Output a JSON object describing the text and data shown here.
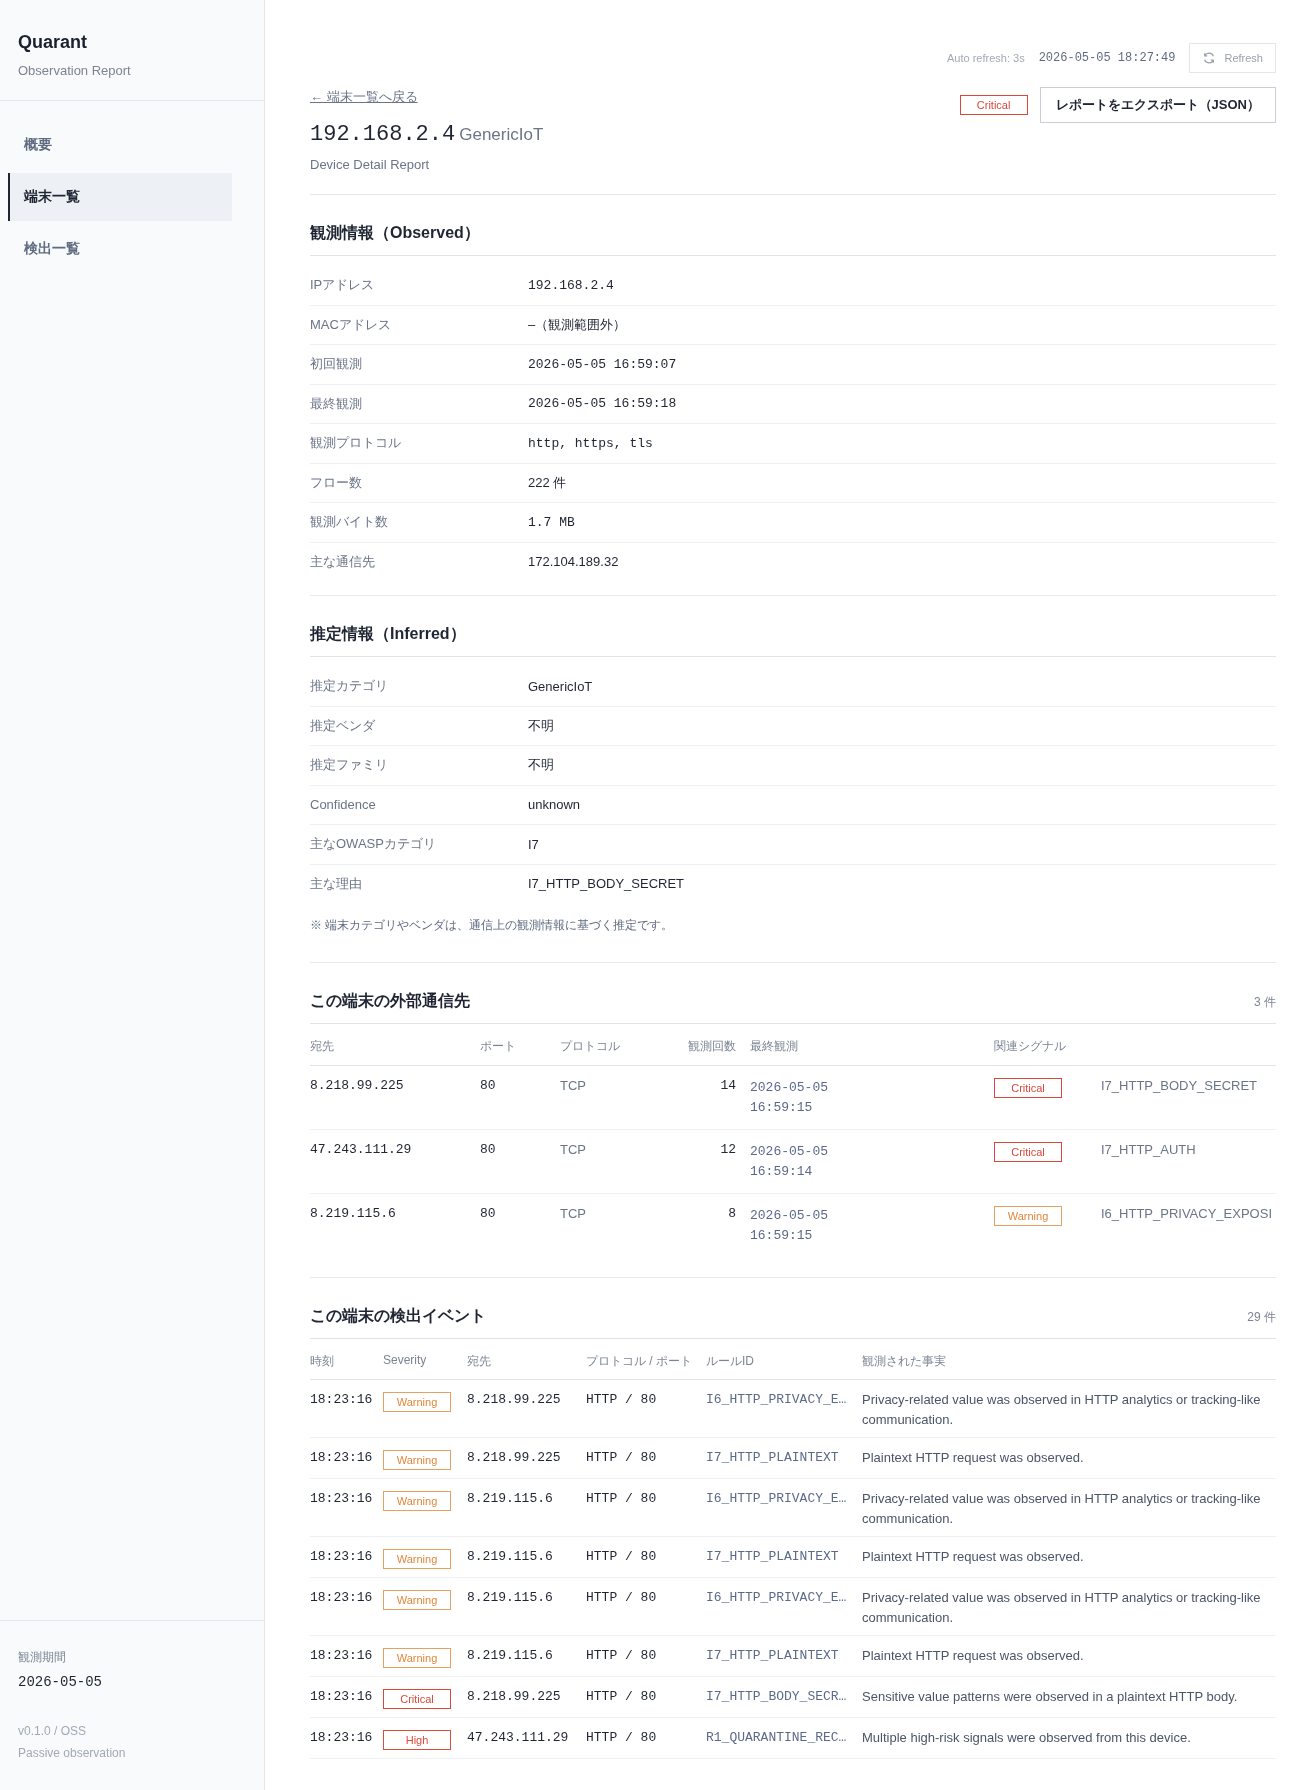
{
  "sidebar": {
    "brand": "Quarant",
    "subtitle": "Observation Report",
    "items": [
      {
        "label": "概要",
        "selected": false
      },
      {
        "label": "端末一覧",
        "selected": true
      },
      {
        "label": "検出一覧",
        "selected": false
      }
    ],
    "footer": {
      "period_label": "観測期間",
      "period": "2026-05-05",
      "version": "v0.1.0 / OSS",
      "mode": "Passive observation"
    }
  },
  "topbar": {
    "auto_refresh": "Auto refresh: 3s",
    "timestamp": "2026-05-05 18:27:49",
    "refresh_button": "Refresh"
  },
  "header": {
    "back_link": "← 端末一覧へ戻る",
    "ip": "192.168.2.4",
    "category": "GenericIoT",
    "subtitle": "Device Detail Report",
    "severity": {
      "label": "Critical",
      "kind": "critical"
    },
    "export_button": "レポートをエクスポート（JSON）"
  },
  "observed": {
    "title": "観測情報（Observed）",
    "rows": [
      {
        "label": "IPアドレス",
        "value": "192.168.2.4",
        "kind": "mono"
      },
      {
        "label": "MACアドレス",
        "value": "–（観測範囲外）",
        "kind": "text"
      },
      {
        "label": "初回観測",
        "value": "2026-05-05 16:59:07",
        "kind": "mono"
      },
      {
        "label": "最終観測",
        "value": "2026-05-05 16:59:18",
        "kind": "mono"
      },
      {
        "label": "観測プロトコル",
        "value": "http, https, tls",
        "kind": "mono"
      },
      {
        "label": "フロー数",
        "value": "222 件",
        "kind": "text"
      },
      {
        "label": "観測バイト数",
        "value": "1.7 MB",
        "kind": "mono"
      },
      {
        "label": "主な通信先",
        "value": "172.104.189.32",
        "kind": "text"
      }
    ]
  },
  "inferred": {
    "title": "推定情報（Inferred）",
    "rows": [
      {
        "label": "推定カテゴリ",
        "value": "GenericIoT",
        "kind": "text"
      },
      {
        "label": "推定ベンダ",
        "value": "不明",
        "kind": "text"
      },
      {
        "label": "推定ファミリ",
        "value": "不明",
        "kind": "text"
      },
      {
        "label": "Confidence",
        "value": "unknown",
        "kind": "text"
      },
      {
        "label": "主なOWASPカテゴリ",
        "value": "I7",
        "kind": "text"
      },
      {
        "label": "主な理由",
        "value": "I7_HTTP_BODY_SECRET",
        "kind": "text"
      }
    ],
    "note": "※ 端末カテゴリやベンダは、通信上の観測情報に基づく推定です。"
  },
  "destinations": {
    "title": "この端末の外部通信先",
    "count": "3 件",
    "columns": [
      "宛先",
      "ポート",
      "プロトコル",
      "観測回数",
      "最終観測",
      "関連シグナル"
    ],
    "rows": [
      {
        "destination": "8.218.99.225",
        "port": "80",
        "protocol": "TCP",
        "observations": "14",
        "last_seen": [
          "2026-05-05",
          "16:59:15"
        ],
        "severity": {
          "label": "Critical",
          "kind": "critical"
        },
        "signal": "I7_HTTP_BODY_SECRET"
      },
      {
        "destination": "47.243.111.29",
        "port": "80",
        "protocol": "TCP",
        "observations": "12",
        "last_seen": [
          "2026-05-05",
          "16:59:14"
        ],
        "severity": {
          "label": "Critical",
          "kind": "critical"
        },
        "signal": "I7_HTTP_AUTH"
      },
      {
        "destination": "8.219.115.6",
        "port": "80",
        "protocol": "TCP",
        "observations": "8",
        "last_seen": [
          "2026-05-05",
          "16:59:15"
        ],
        "severity": {
          "label": "Warning",
          "kind": "warning"
        },
        "signal": "I6_HTTP_PRIVACY_EXPOSI"
      }
    ]
  },
  "events": {
    "title": "この端末の検出イベント",
    "count": "29 件",
    "columns": [
      "時刻",
      "Severity",
      "宛先",
      "プロトコル / ポート",
      "ルールID",
      "観測された事実"
    ],
    "rows": [
      {
        "time": "18:23:16",
        "severity": {
          "label": "Warning",
          "kind": "warning"
        },
        "destination": "8.218.99.225",
        "proto_port": "HTTP / 80",
        "rule_id": "I6_HTTP_PRIVACY_E…",
        "fact": "Privacy-related value was observed in HTTP analytics or tracking-like communication."
      },
      {
        "time": "18:23:16",
        "severity": {
          "label": "Warning",
          "kind": "warning"
        },
        "destination": "8.218.99.225",
        "proto_port": "HTTP / 80",
        "rule_id": "I7_HTTP_PLAINTEXT",
        "fact": "Plaintext HTTP request was observed."
      },
      {
        "time": "18:23:16",
        "severity": {
          "label": "Warning",
          "kind": "warning"
        },
        "destination": "8.219.115.6",
        "proto_port": "HTTP / 80",
        "rule_id": "I6_HTTP_PRIVACY_E…",
        "fact": "Privacy-related value was observed in HTTP analytics or tracking-like communication."
      },
      {
        "time": "18:23:16",
        "severity": {
          "label": "Warning",
          "kind": "warning"
        },
        "destination": "8.219.115.6",
        "proto_port": "HTTP / 80",
        "rule_id": "I7_HTTP_PLAINTEXT",
        "fact": "Plaintext HTTP request was observed."
      },
      {
        "time": "18:23:16",
        "severity": {
          "label": "Warning",
          "kind": "warning"
        },
        "destination": "8.219.115.6",
        "proto_port": "HTTP / 80",
        "rule_id": "I6_HTTP_PRIVACY_E…",
        "fact": "Privacy-related value was observed in HTTP analytics or tracking-like communication."
      },
      {
        "time": "18:23:16",
        "severity": {
          "label": "Warning",
          "kind": "warning"
        },
        "destination": "8.219.115.6",
        "proto_port": "HTTP / 80",
        "rule_id": "I7_HTTP_PLAINTEXT",
        "fact": "Plaintext HTTP request was observed."
      },
      {
        "time": "18:23:16",
        "severity": {
          "label": "Critical",
          "kind": "critical"
        },
        "destination": "8.218.99.225",
        "proto_port": "HTTP / 80",
        "rule_id": "I7_HTTP_BODY_SECR…",
        "fact": "Sensitive value patterns were observed in a plaintext HTTP body."
      },
      {
        "time": "18:23:16",
        "severity": {
          "label": "High",
          "kind": "high"
        },
        "destination": "47.243.111.29",
        "proto_port": "HTTP / 80",
        "rule_id": "R1_QUARANTINE_REC…",
        "fact": "Multiple high-risk signals were observed from this device."
      }
    ]
  }
}
